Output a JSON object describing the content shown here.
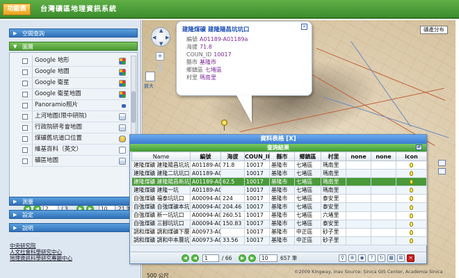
{
  "header": {
    "menu_label": "功能表",
    "title": "台灣礦區地理資訊系統",
    "colors": {
      "bar": "#4a9e36",
      "menu_button": "#f0b030"
    }
  },
  "sidebar": {
    "panels": {
      "spatial_query": "空間查詢",
      "layers": "圖層",
      "measure": "測量",
      "settings": "設定",
      "help": "說明"
    },
    "layer_items": [
      {
        "label": "Google 地形",
        "icon": "google-icon"
      },
      {
        "label": "Google 地圖",
        "icon": "google-icon"
      },
      {
        "label": "Google 衛星",
        "icon": "google-icon"
      },
      {
        "label": "Google 衛星地圖",
        "icon": "google-icon"
      },
      {
        "label": "Panoramio照片",
        "icon": "panoramio-icon"
      },
      {
        "label": "上河地圖(限中研院)",
        "icon": "document-icon"
      },
      {
        "label": "行政院研考會地圖",
        "icon": "document-icon"
      },
      {
        "label": "煤礦舊坑道口位置",
        "icon": "database-icon"
      },
      {
        "label": "維基百科（英文）",
        "icon": "page-icon"
      },
      {
        "label": "礦區地圖",
        "icon": "document-icon"
      }
    ],
    "pager": {
      "page": "2",
      "of_pages": "/ 3",
      "per_page": "10",
      "total": "21 筆"
    },
    "credits": [
      "中央研究院",
      "人文社會科學研究中心",
      "地理資訊科學研究專題中心"
    ]
  },
  "map": {
    "map_type_button": "礦產分布",
    "magnify_label": "放大",
    "scale_label": "500 公尺",
    "copyright": "©2009 Kingway, Inav Source: Sinica GIS Center, Academia Sinica",
    "popup": {
      "title": "建隆煤礦 建隆陽昌坑坑口",
      "fields": [
        {
          "label": "編號",
          "value": "A01189-A01189a"
        },
        {
          "label": "海拔",
          "value": "71.8"
        },
        {
          "label": "COUN_ID",
          "value": "10017"
        },
        {
          "label": "縣市",
          "value": "基隆市"
        },
        {
          "label": "鄉鎮區",
          "value": "七堵區"
        },
        {
          "label": "村里",
          "value": "瑪南里"
        }
      ]
    }
  },
  "data_table": {
    "window_title": "資料表格 [X]",
    "subtitle": "查詢結果",
    "columns": [
      "Name",
      "編號",
      "海拔",
      "COUN_II",
      "縣市",
      "鄉鎮區",
      "村里",
      "none",
      "none",
      "icon"
    ],
    "rows": [
      [
        "建隆煤礦 建隆陽昌坑坑口",
        "A01189-A0",
        "71.8",
        "10017",
        "基隆市",
        "七堵區",
        "瑪南里",
        "",
        ""
      ],
      [
        "建隆煤礦 建隆二坑坑口",
        "A01189-A0",
        "",
        "10017",
        "基隆市",
        "七堵區",
        "瑪南里",
        "",
        ""
      ],
      [
        "建隆煤礦 建隆陽昌新坑",
        "A01189-A0",
        "62.5",
        "10017",
        "基隆市",
        "七堵區",
        "瑪南里",
        "",
        ""
      ],
      [
        "建隆煤礦 建隆一坑",
        "A01189-A0",
        "",
        "10017",
        "基隆市",
        "七堵區",
        "瑪南里",
        "",
        ""
      ],
      [
        "自強煤礦 福泰坑坑口",
        "A00094-A0",
        "224",
        "10017",
        "基隆市",
        "七堵區",
        "泰安里",
        "",
        ""
      ],
      [
        "自強煤礦 自強煤礦本坑",
        "A00094-A0",
        "204.46",
        "10017",
        "基隆市",
        "七堵區",
        "泰安里",
        "",
        ""
      ],
      [
        "自強煤礦 新一坑坑口",
        "A00094-A0",
        "260.51",
        "10017",
        "基隆市",
        "七堵區",
        "六堵里",
        "",
        ""
      ],
      [
        "自強煤礦 三腳坑坑口",
        "A00094-A0",
        "150.83",
        "10017",
        "基隆市",
        "七堵區",
        "泰安里",
        "",
        ""
      ],
      [
        "調和煤礦 調和煤礦下層",
        "A00973-A0",
        "",
        "10017",
        "基隆市",
        "中正區",
        "砂子里",
        "",
        ""
      ],
      [
        "調和煤礦 調和中本層坑",
        "A00973-A0",
        "33.56",
        "10017",
        "基隆市",
        "中正區",
        "砂子里",
        "",
        ""
      ]
    ],
    "selected_row": 2,
    "pager": {
      "page": "1",
      "of_pages": "/ 66",
      "per_page": "10",
      "total": "657 筆"
    },
    "colors": {
      "title_bar": "#4a8ad8",
      "sub_bar": "#4faa3c",
      "selected_row": "#4a9a3a"
    }
  }
}
